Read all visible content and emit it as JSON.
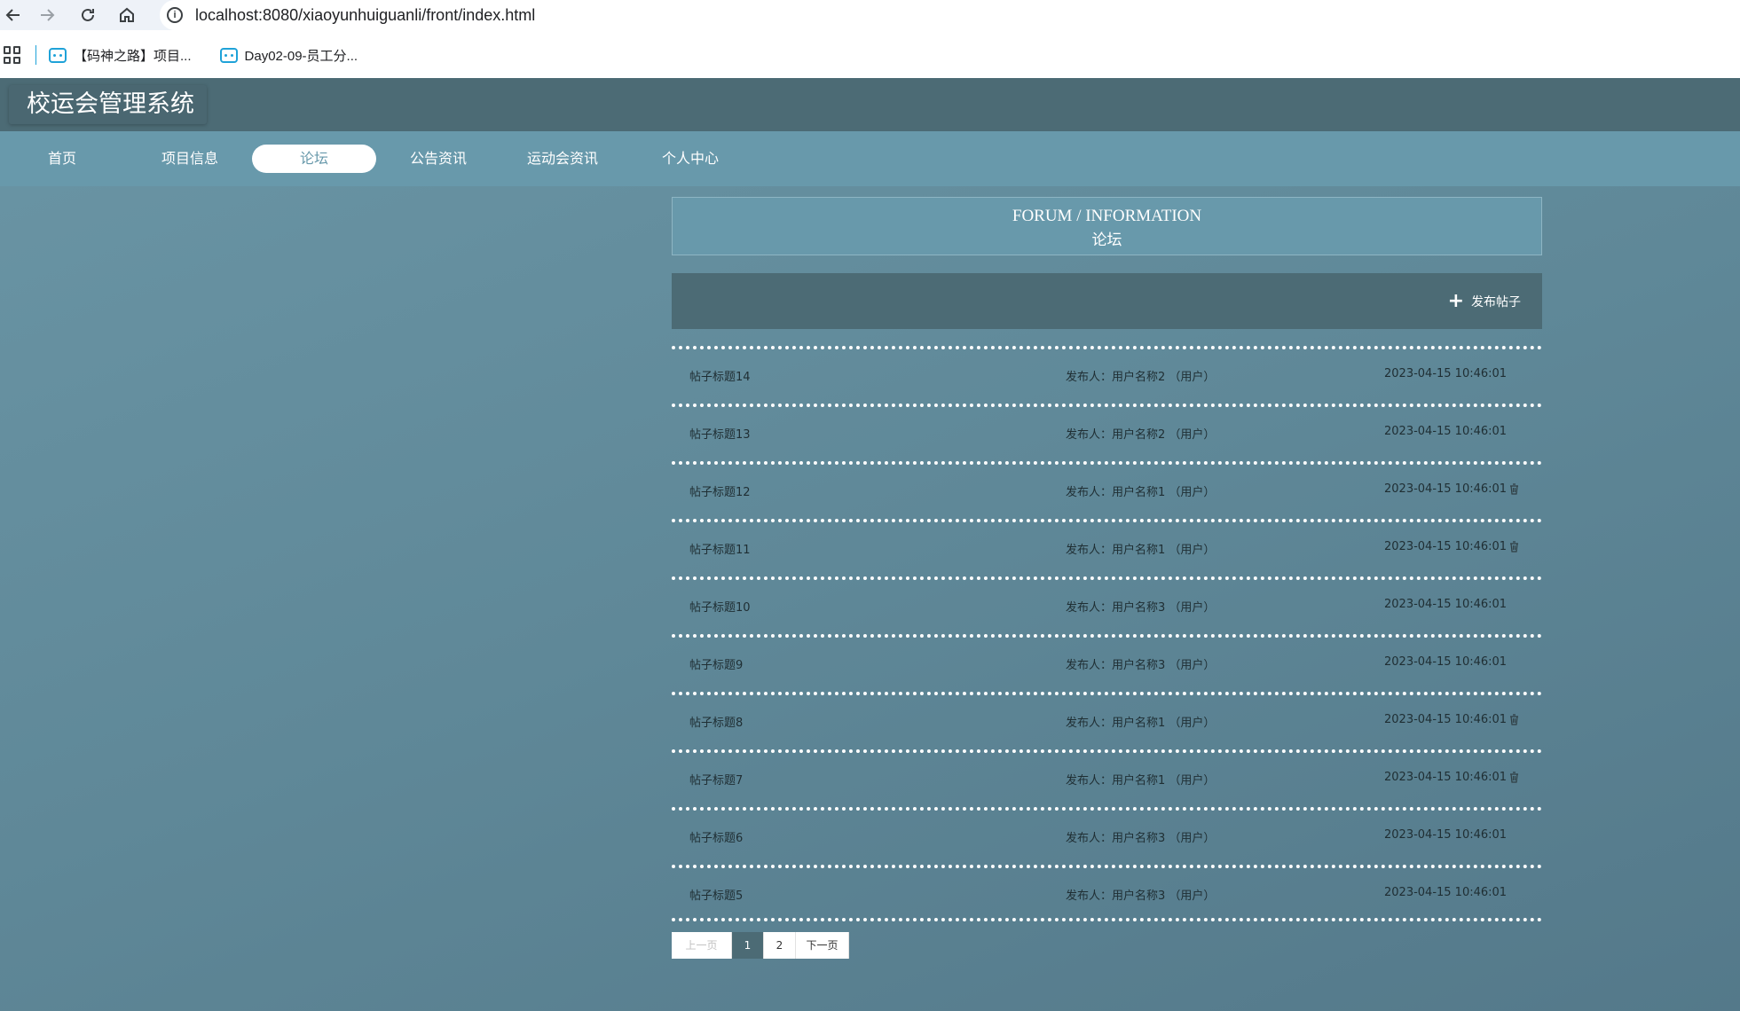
{
  "browser": {
    "url": "localhost:8080/xiaoyunhuiguanli/front/index.html",
    "bookmarks": [
      {
        "label": "【码神之路】项目..."
      },
      {
        "label": "Day02-09-员工分..."
      }
    ]
  },
  "site": {
    "title": "校运会管理系统",
    "menu": [
      "首页",
      "项目信息",
      "论坛",
      "公告资讯",
      "运动会资讯",
      "个人中心"
    ],
    "active_menu": "论坛"
  },
  "forum": {
    "heading_en": "FORUM / INFORMATION",
    "heading_zh": "论坛",
    "publish_label": "发布帖子",
    "posts": [
      {
        "title": "帖子标题14",
        "author": "发布人：用户名称2 （用户）",
        "time": "2023-04-15 10:46:01",
        "deletable": false
      },
      {
        "title": "帖子标题13",
        "author": "发布人：用户名称2 （用户）",
        "time": "2023-04-15 10:46:01",
        "deletable": false
      },
      {
        "title": "帖子标题12",
        "author": "发布人：用户名称1 （用户）",
        "time": "2023-04-15 10:46:01",
        "deletable": true
      },
      {
        "title": "帖子标题11",
        "author": "发布人：用户名称1 （用户）",
        "time": "2023-04-15 10:46:01",
        "deletable": true
      },
      {
        "title": "帖子标题10",
        "author": "发布人：用户名称3 （用户）",
        "time": "2023-04-15 10:46:01",
        "deletable": false
      },
      {
        "title": "帖子标题9",
        "author": "发布人：用户名称3 （用户）",
        "time": "2023-04-15 10:46:01",
        "deletable": false
      },
      {
        "title": "帖子标题8",
        "author": "发布人：用户名称1 （用户）",
        "time": "2023-04-15 10:46:01",
        "deletable": true
      },
      {
        "title": "帖子标题7",
        "author": "发布人：用户名称1 （用户）",
        "time": "2023-04-15 10:46:01",
        "deletable": true
      },
      {
        "title": "帖子标题6",
        "author": "发布人：用户名称3 （用户）",
        "time": "2023-04-15 10:46:01",
        "deletable": false
      },
      {
        "title": "帖子标题5",
        "author": "发布人：用户名称3 （用户）",
        "time": "2023-04-15 10:46:01",
        "deletable": false
      }
    ]
  },
  "pager": {
    "prev": "上一页",
    "pages": [
      "1",
      "2"
    ],
    "current": "1",
    "next": "下一页"
  },
  "colors": {
    "header": "#4c6b75",
    "menu": "#6899ab",
    "accent": "#4c6b75"
  }
}
